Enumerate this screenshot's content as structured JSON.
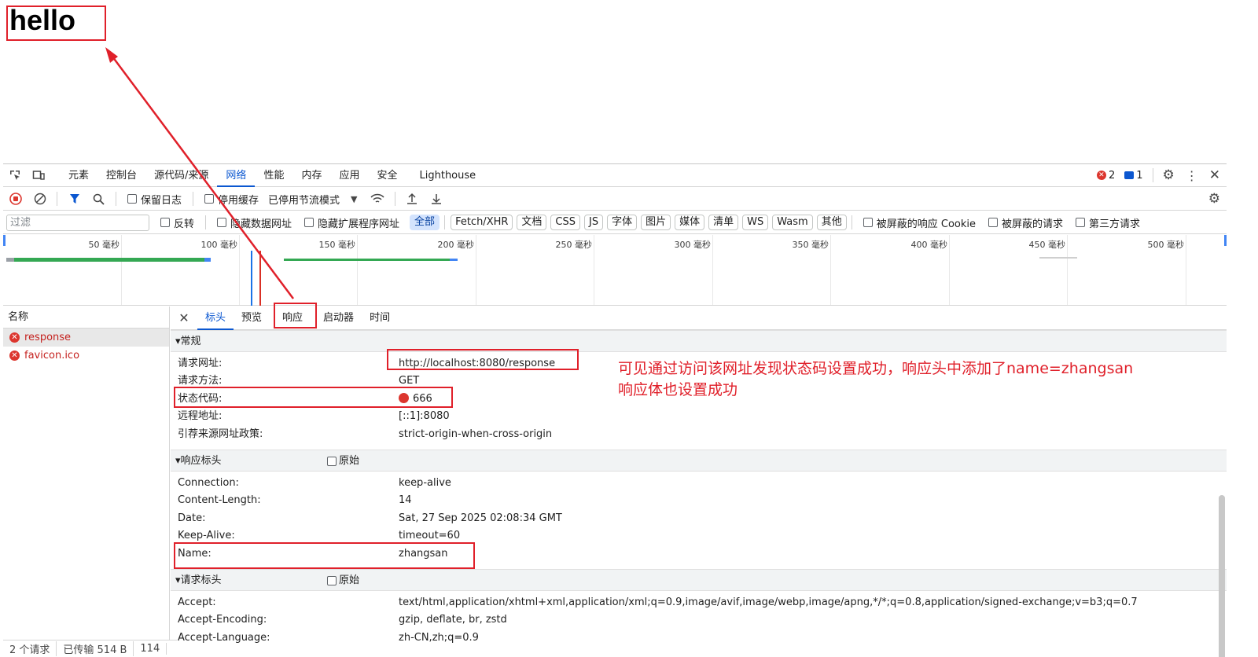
{
  "page": {
    "hello": "hello"
  },
  "devtools": {
    "tabs": [
      "元素",
      "控制台",
      "源代码/来源",
      "网络",
      "性能",
      "内存",
      "应用",
      "安全",
      "Lighthouse"
    ],
    "active_tab": "网络",
    "errors_count": "2",
    "messages_count": "1",
    "toolbar": {
      "preserve_log": "保留日志",
      "disable_cache": "停用缓存",
      "throttle": "已停用节流模式"
    },
    "filter": {
      "placeholder": "过滤",
      "invert": "反转",
      "hide_data_urls": "隐藏数据网址",
      "hide_ext_urls": "隐藏扩展程序网址",
      "types": [
        "全部",
        "Fetch/XHR",
        "文档",
        "CSS",
        "JS",
        "字体",
        "图片",
        "媒体",
        "清单",
        "WS",
        "Wasm",
        "其他"
      ],
      "blocked_cookies": "被屏蔽的响应 Cookie",
      "blocked_requests": "被屏蔽的请求",
      "third_party": "第三方请求"
    },
    "overview_labels": [
      "50 毫秒",
      "100 毫秒",
      "150 毫秒",
      "200 毫秒",
      "250 毫秒",
      "300 毫秒",
      "350 毫秒",
      "400 毫秒",
      "450 毫秒",
      "500 毫秒"
    ],
    "requests_header": "名称",
    "requests": [
      "response",
      "favicon.ico"
    ],
    "status_bar": [
      "2 个请求",
      "已传输 514 B",
      "114"
    ],
    "detail_tabs": [
      "标头",
      "预览",
      "响应",
      "启动器",
      "时间"
    ],
    "active_detail_tab": "标头",
    "general": {
      "title": "▾常规",
      "rows": [
        {
          "k": "请求网址:",
          "v": "http://localhost:8080/response"
        },
        {
          "k": "请求方法:",
          "v": "GET"
        },
        {
          "k": "状态代码:",
          "v": "666"
        },
        {
          "k": "远程地址:",
          "v": "[::1]:8080"
        },
        {
          "k": "引荐来源网址政策:",
          "v": "strict-origin-when-cross-origin"
        }
      ]
    },
    "response_headers": {
      "title": "▾响应标头",
      "raw": "原始",
      "rows": [
        {
          "k": "Connection:",
          "v": "keep-alive"
        },
        {
          "k": "Content-Length:",
          "v": "14"
        },
        {
          "k": "Date:",
          "v": "Sat, 27 Sep 2025 02:08:34 GMT"
        },
        {
          "k": "Keep-Alive:",
          "v": "timeout=60"
        },
        {
          "k": "Name:",
          "v": "zhangsan"
        }
      ]
    },
    "request_headers": {
      "title": "▾请求标头",
      "raw": "原始",
      "rows": [
        {
          "k": "Accept:",
          "v": "text/html,application/xhtml+xml,application/xml;q=0.9,image/avif,image/webp,image/apng,*/*;q=0.8,application/signed-exchange;v=b3;q=0.7"
        },
        {
          "k": "Accept-Encoding:",
          "v": "gzip, deflate, br, zstd"
        },
        {
          "k": "Accept-Language:",
          "v": "zh-CN,zh;q=0.9"
        }
      ]
    }
  },
  "annotation": {
    "line1": "可见通过访问该网址发现状态码设置成功，响应头中添加了name=zhangsan",
    "line2": "响应体也设置成功",
    "color": "#e0202a"
  }
}
